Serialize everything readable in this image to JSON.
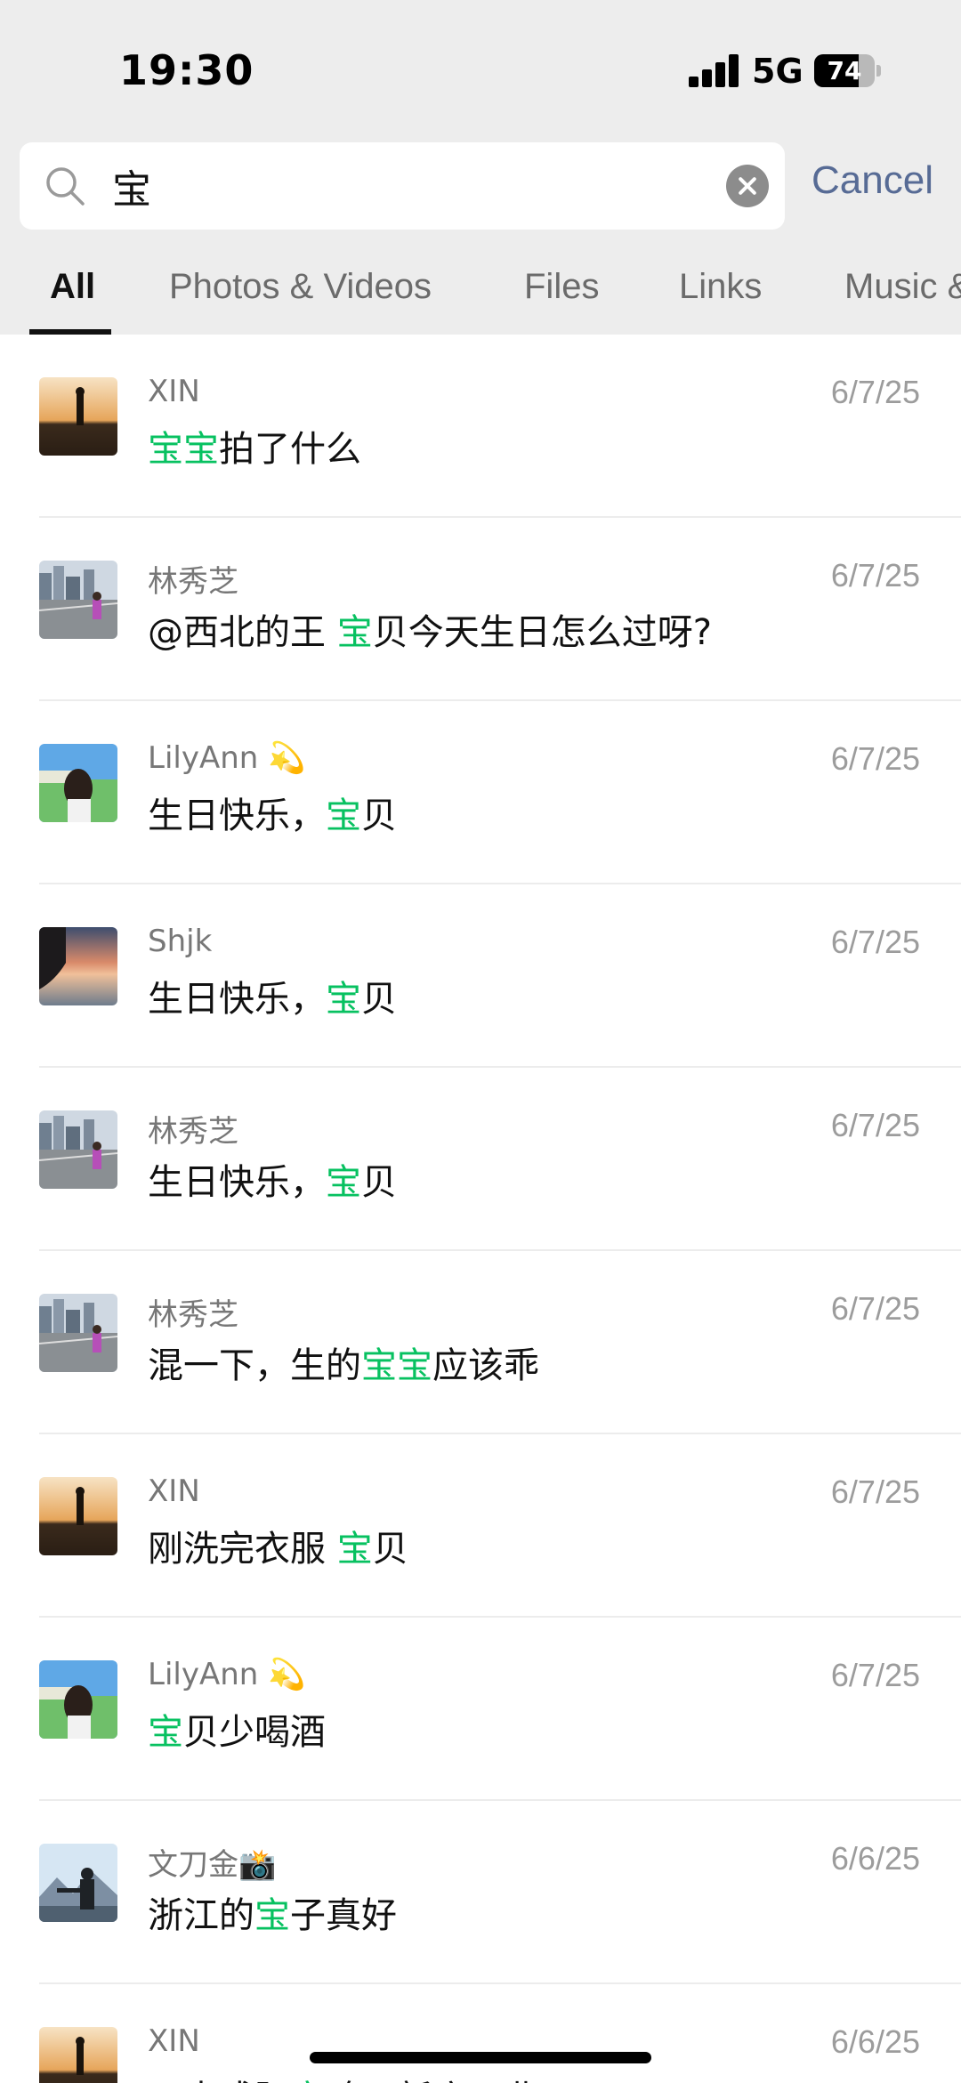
{
  "status_bar": {
    "time": "19:30",
    "network": "5G",
    "battery": "74",
    "battery_level": 0.74
  },
  "search": {
    "query": "宝",
    "cancel_label": "Cancel"
  },
  "tabs": [
    {
      "label": "All",
      "active": true
    },
    {
      "label": "Photos & Videos",
      "active": false
    },
    {
      "label": "Files",
      "active": false
    },
    {
      "label": "Links",
      "active": false
    },
    {
      "label": "Music &",
      "active": false
    }
  ],
  "results": [
    {
      "sender": "XIN",
      "avatar": "sunset-man",
      "date": "6/7/25",
      "message": [
        {
          "t": "宝宝",
          "h": true
        },
        {
          "t": "拍了什么",
          "h": false
        }
      ]
    },
    {
      "sender": "林秀芝",
      "avatar": "city-girl",
      "date": "6/7/25",
      "message": [
        {
          "t": "@西北的王 ",
          "h": false
        },
        {
          "t": "宝",
          "h": true
        },
        {
          "t": "贝今天生日怎么过呀?",
          "h": false
        }
      ]
    },
    {
      "sender": "LilyAnn 💫",
      "avatar": "beach-girl",
      "date": "6/7/25",
      "message": [
        {
          "t": "生日快乐，",
          "h": false
        },
        {
          "t": "宝",
          "h": true
        },
        {
          "t": "贝",
          "h": false
        }
      ]
    },
    {
      "sender": "Shjk",
      "avatar": "sunset-sea",
      "date": "6/7/25",
      "message": [
        {
          "t": "生日快乐，",
          "h": false
        },
        {
          "t": "宝",
          "h": true
        },
        {
          "t": "贝",
          "h": false
        }
      ]
    },
    {
      "sender": "林秀芝",
      "avatar": "city-girl",
      "date": "6/7/25",
      "message": [
        {
          "t": "生日快乐，",
          "h": false
        },
        {
          "t": "宝",
          "h": true
        },
        {
          "t": "贝",
          "h": false
        }
      ]
    },
    {
      "sender": "林秀芝",
      "avatar": "city-girl",
      "date": "6/7/25",
      "message": [
        {
          "t": "混一下，生的",
          "h": false
        },
        {
          "t": "宝宝",
          "h": true
        },
        {
          "t": "应该乖",
          "h": false
        }
      ]
    },
    {
      "sender": "XIN",
      "avatar": "sunset-man",
      "date": "6/7/25",
      "message": [
        {
          "t": "刚洗完衣服 ",
          "h": false
        },
        {
          "t": "宝",
          "h": true
        },
        {
          "t": "贝",
          "h": false
        }
      ]
    },
    {
      "sender": "LilyAnn 💫",
      "avatar": "beach-girl",
      "date": "6/7/25",
      "message": [
        {
          "t": "宝",
          "h": true
        },
        {
          "t": "贝少喝酒",
          "h": false
        }
      ]
    },
    {
      "sender": "文刀金📸",
      "avatar": "mountain-man",
      "date": "6/6/25",
      "message": [
        {
          "t": "浙江的",
          "h": false
        },
        {
          "t": "宝",
          "h": true
        },
        {
          "t": "子真好",
          "h": false
        }
      ]
    },
    {
      "sender": "XIN",
      "avatar": "sunset-man",
      "date": "6/6/25",
      "message": [
        {
          "t": "日本成阳",
          "h": false
        },
        {
          "t": "宝",
          "h": true
        },
        {
          "t": "鸡开新店开业",
          "h": false
        }
      ]
    }
  ]
}
